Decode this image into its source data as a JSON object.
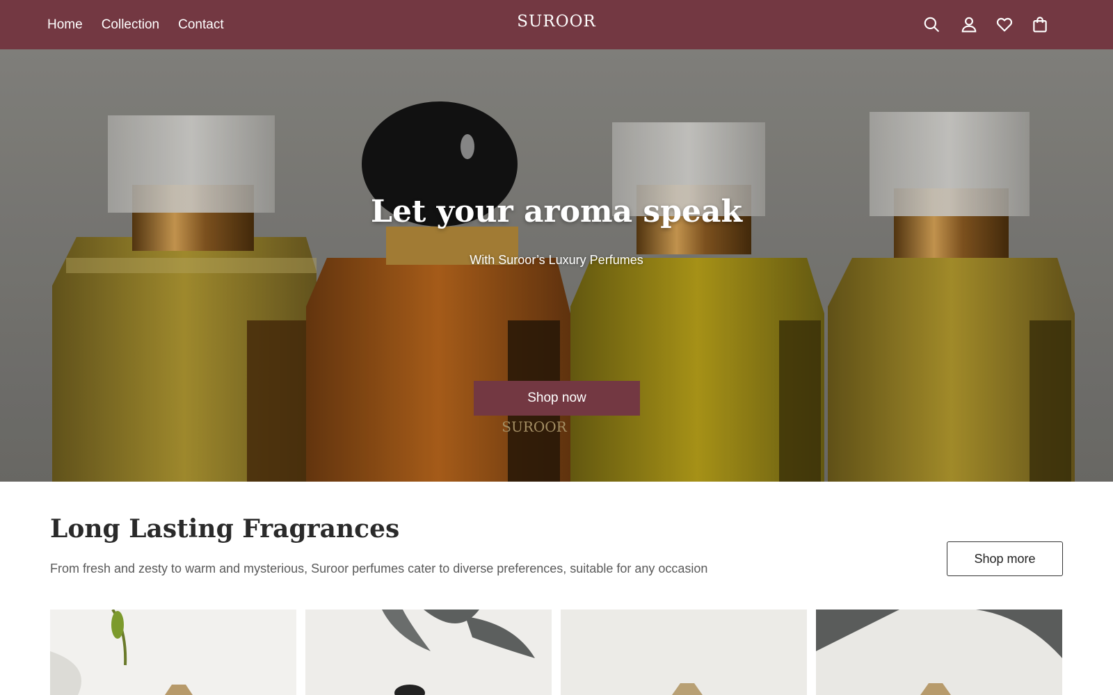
{
  "header": {
    "nav": [
      "Home",
      "Collection",
      "Contact"
    ],
    "brand": "SUROOR",
    "icons": [
      "search-icon",
      "account-icon",
      "wishlist-icon",
      "cart-icon"
    ],
    "background_color": "#733842"
  },
  "hero": {
    "title": "Let your aroma speak",
    "subtitle": "With Suroor’s Luxury Perfumes",
    "cta_label": "Shop now",
    "bottle_label": "SUROOR"
  },
  "section": {
    "title": "Long Lasting Fragrances",
    "description": "From fresh and zesty to warm and mysterious, Suroor perfumes cater to diverse preferences, suitable for any occasion",
    "cta_label": "Shop more"
  },
  "products": [
    {
      "image": "perfume-bottle-with-leaf"
    },
    {
      "image": "perfume-bottle-black-cap-shadow"
    },
    {
      "image": "perfume-bottle-light"
    },
    {
      "image": "perfume-bottle-leaf-shadow"
    }
  ]
}
